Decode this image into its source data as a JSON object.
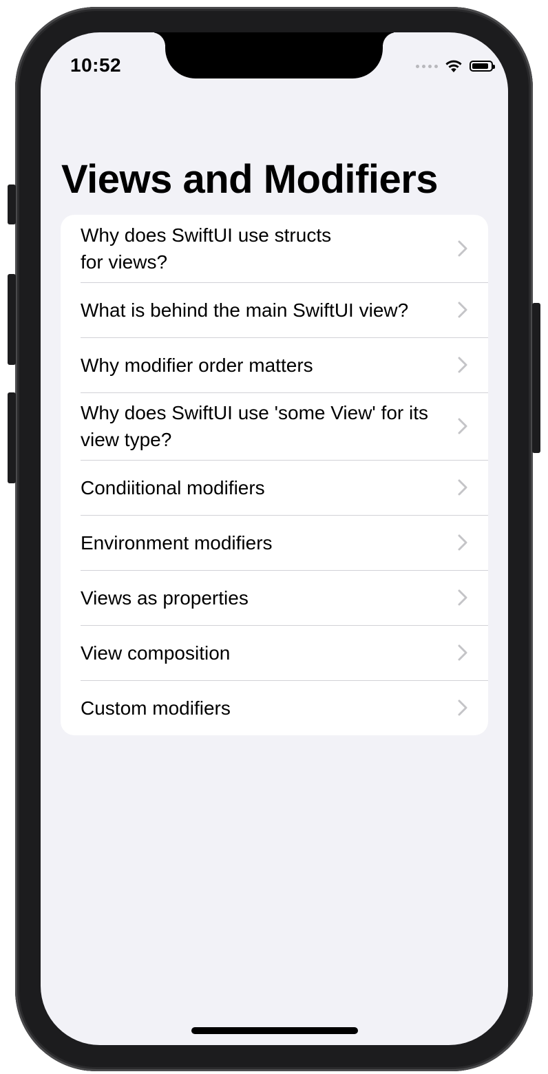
{
  "status_bar": {
    "time": "10:52"
  },
  "page": {
    "title": "Views and Modifiers"
  },
  "list": {
    "items": [
      {
        "label": "Why does SwiftUI use structs\nfor views?"
      },
      {
        "label": "What is behind the main SwiftUI view?"
      },
      {
        "label": "Why modifier order matters"
      },
      {
        "label": "Why does SwiftUI use 'some View' for its view type?"
      },
      {
        "label": "Condiitional modifiers"
      },
      {
        "label": "Environment modifiers"
      },
      {
        "label": "Views as properties"
      },
      {
        "label": "View composition"
      },
      {
        "label": "Custom modifiers"
      }
    ]
  },
  "colors": {
    "background": "#f2f2f7",
    "card": "#ffffff",
    "separator": "#d1d1d6",
    "chevron": "#c4c4c7",
    "text": "#000000"
  },
  "icons": {
    "row_disclosure": "chevron-right-icon",
    "wifi": "wifi-icon",
    "battery": "battery-icon",
    "signal": "cellular-signal-icon"
  },
  "battery_level": 0.9
}
